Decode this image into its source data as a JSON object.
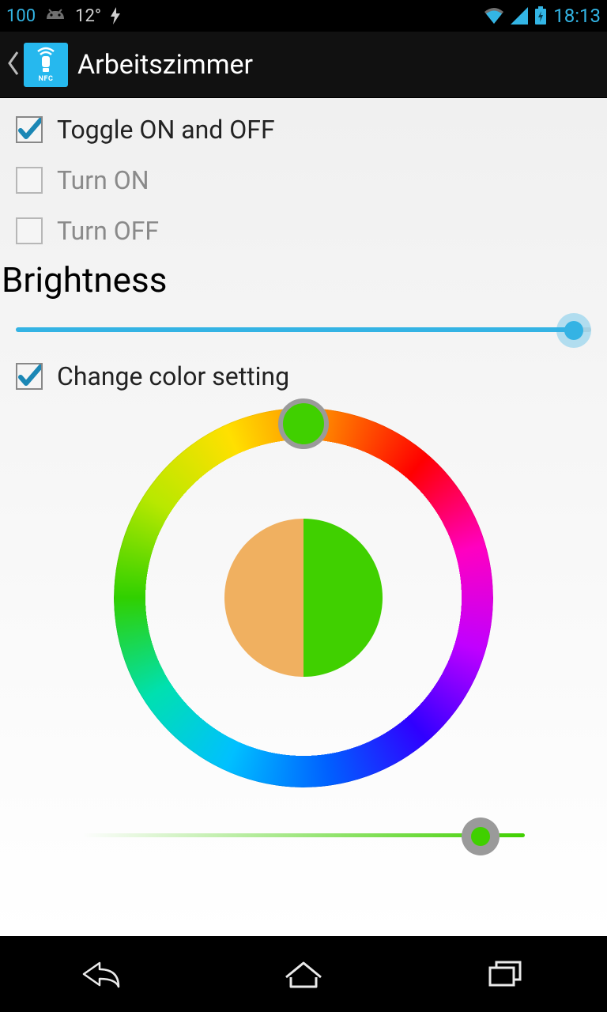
{
  "status": {
    "battery_text": "100",
    "temp": "12°",
    "time": "18:13"
  },
  "header": {
    "title": "Arbeitszimmer",
    "app_icon_text": "NFC"
  },
  "options": {
    "toggle": {
      "label": "Toggle ON and OFF",
      "checked": true
    },
    "turn_on": {
      "label": "Turn ON",
      "checked": false
    },
    "turn_off": {
      "label": "Turn OFF",
      "checked": false
    }
  },
  "brightness": {
    "label": "Brightness",
    "percent": 97
  },
  "color": {
    "change_label": "Change color setting",
    "change_checked": true,
    "selected_hex": "#40d000",
    "preview_left_hex": "#f0b060",
    "preview_right_hex": "#40d000",
    "saturation_percent": 90
  }
}
